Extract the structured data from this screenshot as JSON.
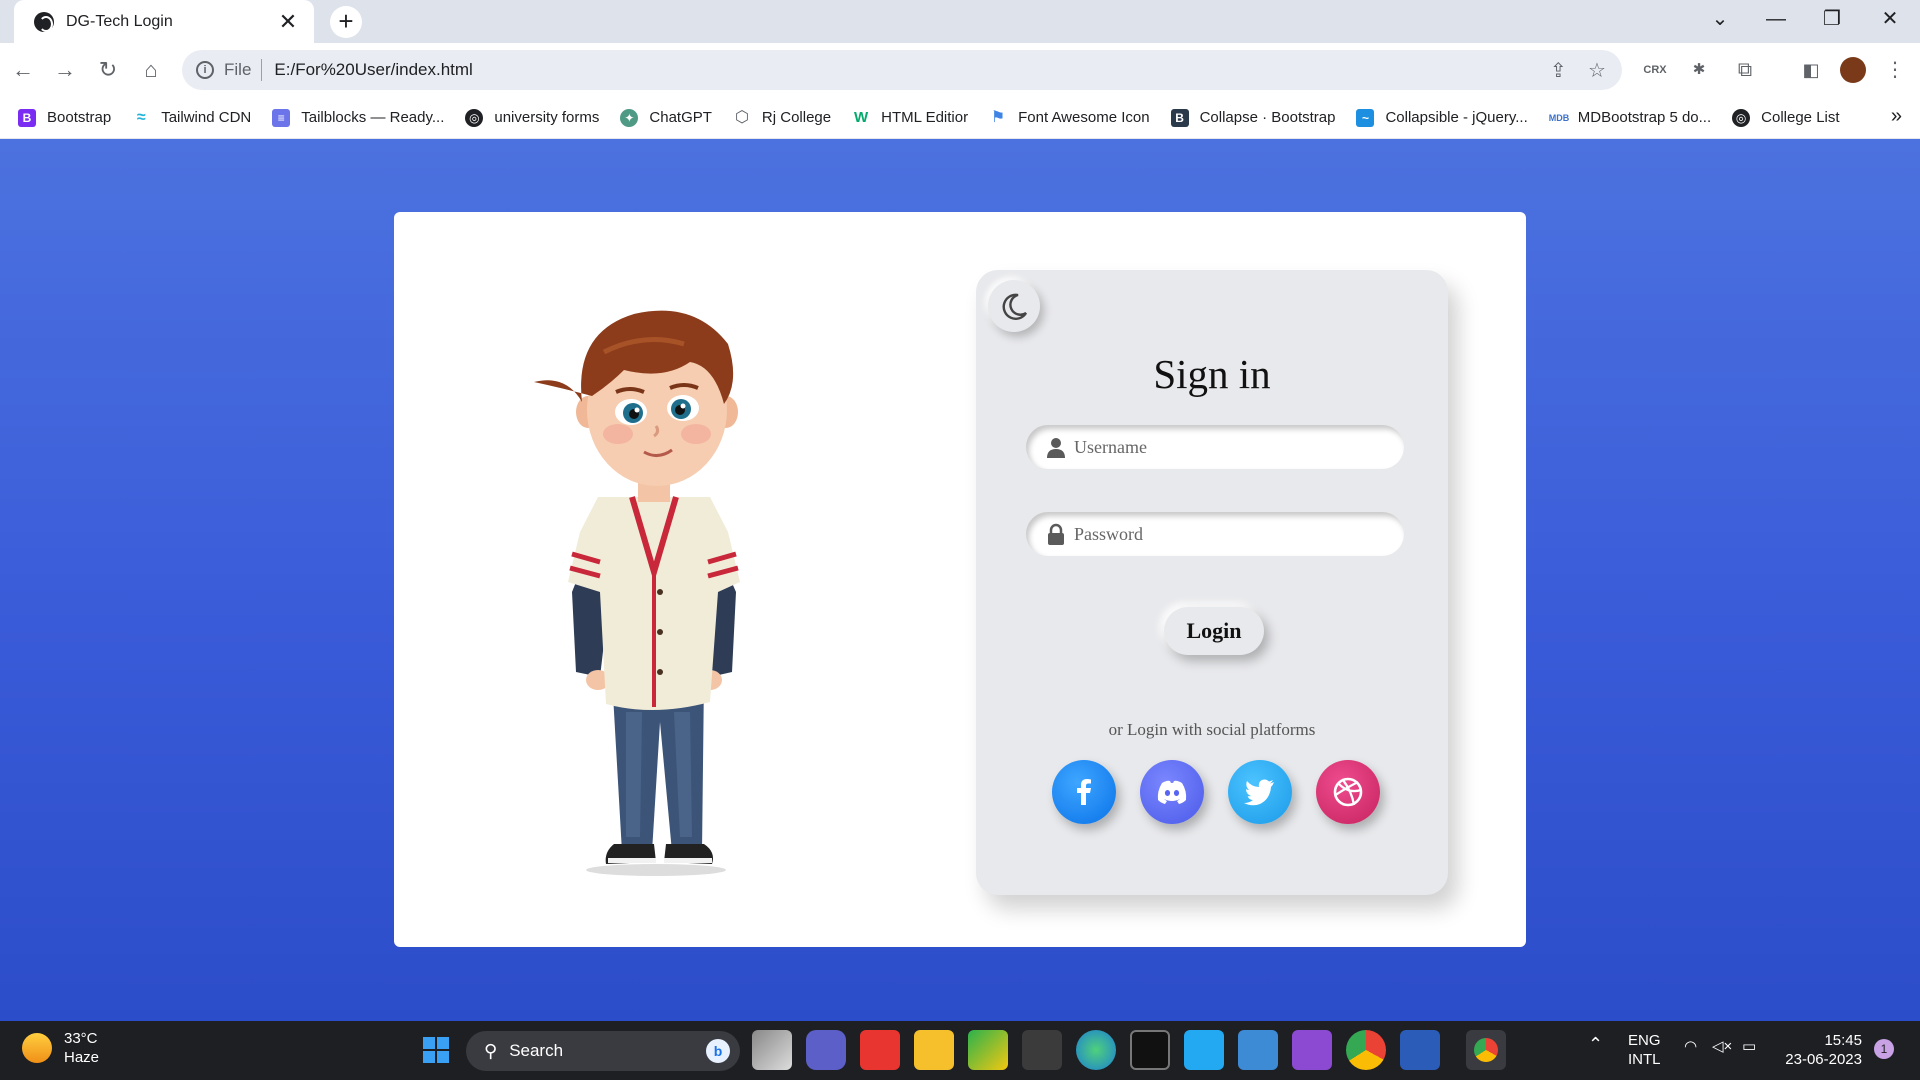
{
  "browser": {
    "tab_title": "DG-Tech Login",
    "url_scheme": "File",
    "url": "E:/For%20User/index.html",
    "bookmarks": [
      {
        "label": "Bootstrap",
        "icon": "bootstrap-icon",
        "color": "#7b2cf2"
      },
      {
        "label": "Tailwind CDN",
        "icon": "tailwind-icon",
        "color": "#22b3d8"
      },
      {
        "label": "Tailblocks — Ready...",
        "icon": "tailblocks-icon",
        "color": "#6b74e8"
      },
      {
        "label": "university forms",
        "icon": "globe-icon",
        "color": "#202124"
      },
      {
        "label": "ChatGPT",
        "icon": "chatgpt-icon",
        "color": "#4e9a84"
      },
      {
        "label": "Rj College",
        "icon": "college-icon",
        "color": "#5f6368"
      },
      {
        "label": "HTML Editior",
        "icon": "w3-icon",
        "color": "#04aa6d"
      },
      {
        "label": "Font Awesome Icon",
        "icon": "flag-icon",
        "color": "#3f84e5"
      },
      {
        "label": "Collapse · Bootstrap",
        "icon": "bootstrap-icon",
        "color": "#2b3a4a"
      },
      {
        "label": "Collapsible - jQuery...",
        "icon": "jquery-icon",
        "color": "#1c8fe0"
      },
      {
        "label": "MDBootstrap 5 do...",
        "icon": "mdb-icon",
        "color": "#3b71ca"
      },
      {
        "label": "College List",
        "icon": "globe-icon",
        "color": "#202124"
      }
    ]
  },
  "login": {
    "heading": "Sign in",
    "username_placeholder": "Username",
    "password_placeholder": "Password",
    "login_label": "Login",
    "social_caption": "or Login with social platforms",
    "social": [
      {
        "name": "facebook",
        "glyph": "f",
        "color": "#1877f2"
      },
      {
        "name": "discord",
        "glyph": "",
        "color": "#5865f2"
      },
      {
        "name": "twitter",
        "glyph": "",
        "color": "#1d9bf0"
      },
      {
        "name": "dribbble",
        "glyph": "",
        "color": "#d5367a"
      }
    ]
  },
  "taskbar": {
    "temp": "33°C",
    "weather": "Haze",
    "search_label": "Search",
    "lang_top": "ENG",
    "lang_bottom": "INTL",
    "time": "15:45",
    "date": "23-06-2023",
    "notification_count": "1"
  },
  "colors": {
    "page_gradient_top": "#4c72df",
    "page_gradient_bottom": "#2c4dc9",
    "panel": "#e8e9ec"
  }
}
